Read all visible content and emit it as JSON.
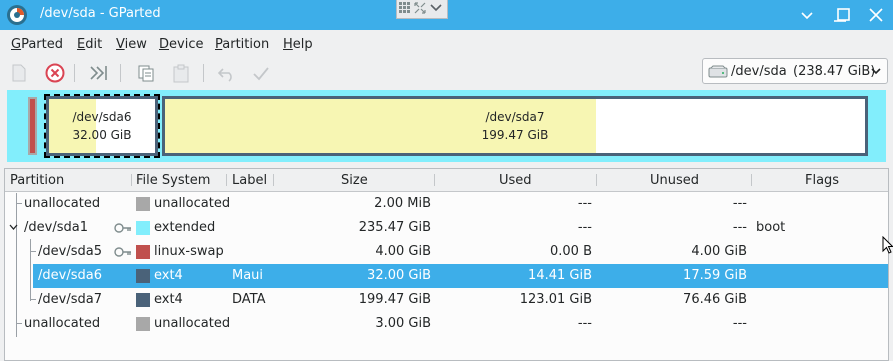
{
  "window": {
    "title": "/dev/sda - GParted"
  },
  "menu": [
    {
      "pre": "G",
      "rest": "Parted"
    },
    {
      "pre": "E",
      "rest": "dit"
    },
    {
      "pre": "V",
      "rest": "iew"
    },
    {
      "pre": "D",
      "rest": "evice"
    },
    {
      "pre": "P",
      "rest": "artition"
    },
    {
      "pre": "H",
      "rest": "elp"
    }
  ],
  "device": {
    "name": "/dev/sda",
    "size": "(238.47 GiB)"
  },
  "diskmap": {
    "sda6": {
      "name": "/dev/sda6",
      "size": "32.00 GiB"
    },
    "sda7": {
      "name": "/dev/sda7",
      "size": "199.47 GiB"
    }
  },
  "columns": [
    "Partition",
    "File System",
    "Label",
    "Size",
    "Used",
    "Unused",
    "Flags"
  ],
  "colors": {
    "unallocated": "#a8a8a8",
    "extended": "#82eefc",
    "linux-swap": "#c0504d",
    "ext4": "#4a6279",
    "used": "#f7f6b3",
    "selection": "#3daee9"
  },
  "rows": [
    {
      "partition": "unallocated",
      "fs": "unallocated",
      "label": "",
      "size": "2.00 MiB",
      "used": "---",
      "unused": "---",
      "flags": "",
      "fs_color": "#a8a8a8"
    },
    {
      "partition": "/dev/sda1",
      "fs": "extended",
      "label": "",
      "size": "235.47 GiB",
      "used": "---",
      "unused": "---",
      "flags": "boot",
      "fs_color": "#82eefc"
    },
    {
      "partition": "/dev/sda5",
      "fs": "linux-swap",
      "label": "",
      "size": "4.00 GiB",
      "used": "0.00 B",
      "unused": "4.00 GiB",
      "flags": "",
      "fs_color": "#c0504d"
    },
    {
      "partition": "/dev/sda6",
      "fs": "ext4",
      "label": "Maui",
      "size": "32.00 GiB",
      "used": "14.41 GiB",
      "unused": "17.59 GiB",
      "flags": "",
      "fs_color": "#4a6279"
    },
    {
      "partition": "/dev/sda7",
      "fs": "ext4",
      "label": "DATA",
      "size": "199.47 GiB",
      "used": "123.01 GiB",
      "unused": "76.46 GiB",
      "flags": "",
      "fs_color": "#4a6279"
    },
    {
      "partition": "unallocated",
      "fs": "unallocated",
      "label": "",
      "size": "3.00 GiB",
      "used": "---",
      "unused": "---",
      "flags": "",
      "fs_color": "#a8a8a8"
    }
  ]
}
